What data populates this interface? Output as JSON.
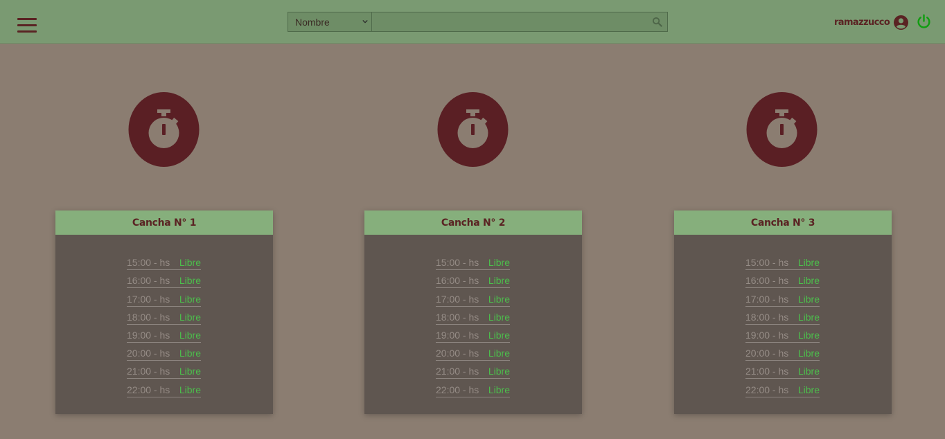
{
  "header": {
    "search": {
      "filter_selected": "Nombre",
      "query": "",
      "placeholder": ""
    },
    "user": {
      "name": "ramazzucco"
    }
  },
  "colors": {
    "header_bg": "#7a9a72",
    "page_bg": "#8b7d71",
    "accent_dark": "#5a2323",
    "card_bg": "#5f5650",
    "card_header_bg": "#86af7c",
    "free_status": "#4cbf4c",
    "power_icon": "#119d11"
  },
  "courts": [
    {
      "title": "Cancha N° 1",
      "icon": "stopwatch-icon",
      "slots": [
        {
          "time": "15:00 - hs",
          "status": "Libre"
        },
        {
          "time": "16:00 - hs",
          "status": "Libre"
        },
        {
          "time": "17:00 - hs",
          "status": "Libre"
        },
        {
          "time": "18:00 - hs",
          "status": "Libre"
        },
        {
          "time": "19:00 - hs",
          "status": "Libre"
        },
        {
          "time": "20:00 - hs",
          "status": "Libre"
        },
        {
          "time": "21:00 - hs",
          "status": "Libre"
        },
        {
          "time": "22:00 - hs",
          "status": "Libre"
        }
      ]
    },
    {
      "title": "Cancha N° 2",
      "icon": "stopwatch-icon",
      "slots": [
        {
          "time": "15:00 - hs",
          "status": "Libre"
        },
        {
          "time": "16:00 - hs",
          "status": "Libre"
        },
        {
          "time": "17:00 - hs",
          "status": "Libre"
        },
        {
          "time": "18:00 - hs",
          "status": "Libre"
        },
        {
          "time": "19:00 - hs",
          "status": "Libre"
        },
        {
          "time": "20:00 - hs",
          "status": "Libre"
        },
        {
          "time": "21:00 - hs",
          "status": "Libre"
        },
        {
          "time": "22:00 - hs",
          "status": "Libre"
        }
      ]
    },
    {
      "title": "Cancha N° 3",
      "icon": "stopwatch-icon",
      "slots": [
        {
          "time": "15:00 - hs",
          "status": "Libre"
        },
        {
          "time": "16:00 - hs",
          "status": "Libre"
        },
        {
          "time": "17:00 - hs",
          "status": "Libre"
        },
        {
          "time": "18:00 - hs",
          "status": "Libre"
        },
        {
          "time": "19:00 - hs",
          "status": "Libre"
        },
        {
          "time": "20:00 - hs",
          "status": "Libre"
        },
        {
          "time": "21:00 - hs",
          "status": "Libre"
        },
        {
          "time": "22:00 - hs",
          "status": "Libre"
        }
      ]
    }
  ]
}
